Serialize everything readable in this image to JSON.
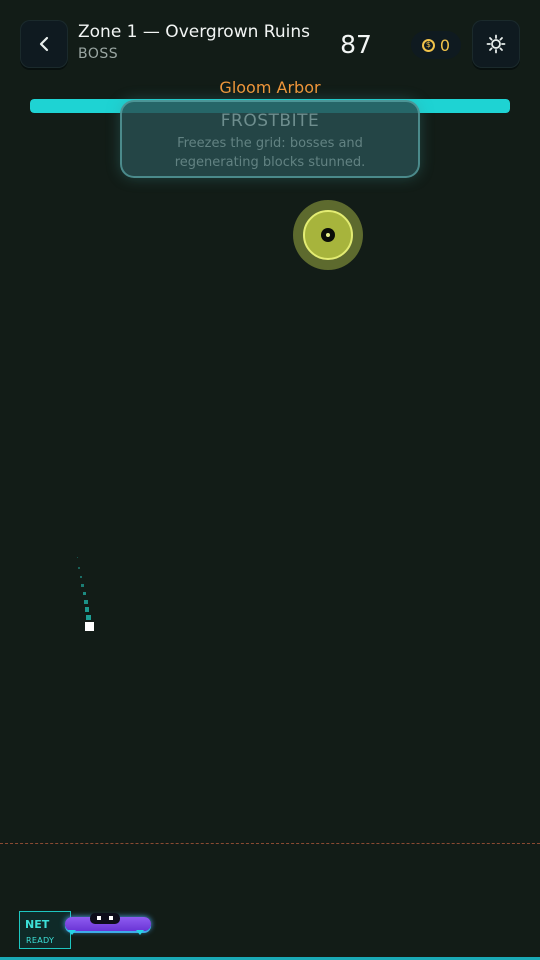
{
  "header": {
    "zone_title": "Zone 1 — Overgrown Ruins",
    "zone_subtitle": "BOSS",
    "score": "87",
    "coins": "0",
    "back_icon": "chevron-left-icon",
    "settings_icon": "gear-icon",
    "coin_icon": "coin-icon"
  },
  "boss": {
    "name": "Gloom Arbor",
    "health_fraction": 1.0,
    "health_color": "#1ed3d3",
    "name_color": "#f0963a",
    "body_color": "#a7b43c"
  },
  "toast": {
    "title": "FROSTBITE",
    "description": "Freezes the grid: bosses and regenerating blocks stunned."
  },
  "net": {
    "label": "NET",
    "status": "READY"
  },
  "colors": {
    "background": "#121c17",
    "accent": "#1ed3d3",
    "coin": "#f0c24a",
    "paddle": "#7a44e0",
    "danger_line": "#8a4a32"
  }
}
